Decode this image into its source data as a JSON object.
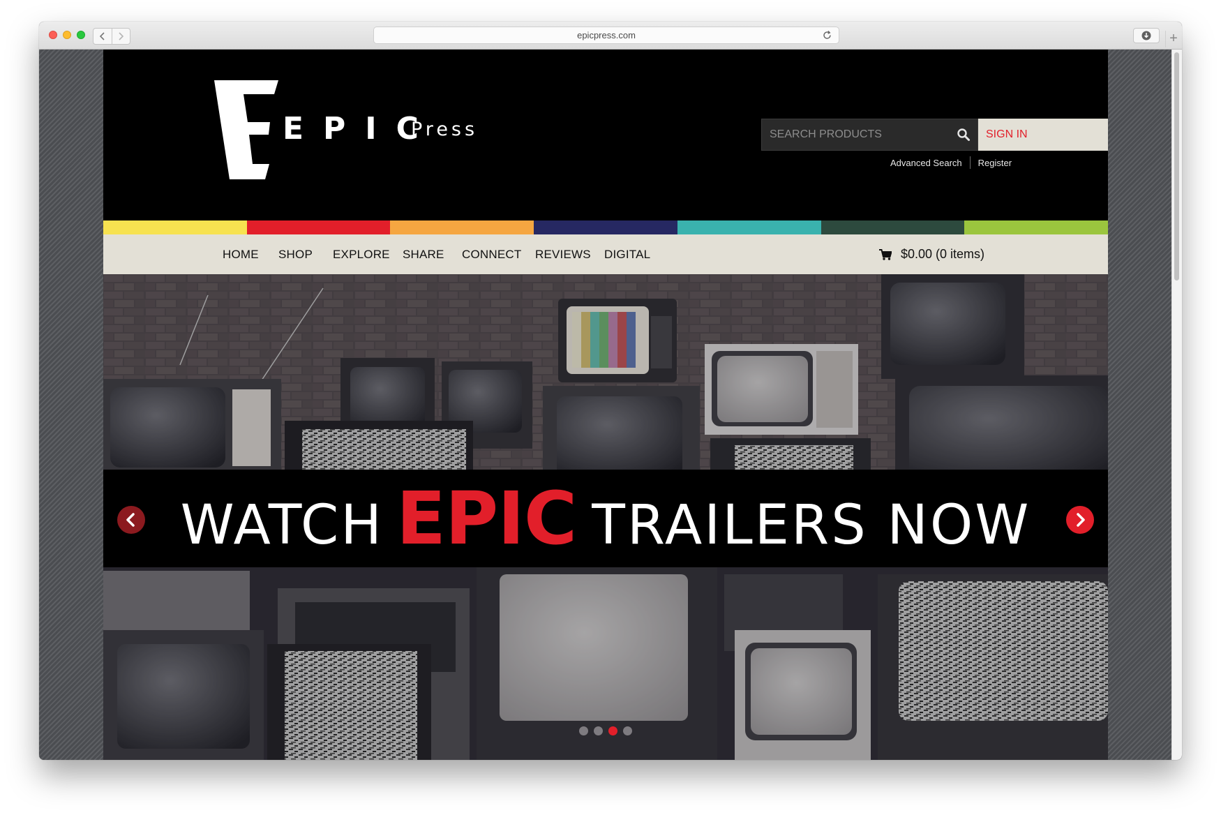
{
  "browser": {
    "url": "epicpress.com",
    "back_icon": "chevron-left-icon",
    "forward_icon": "chevron-right-icon",
    "reload_icon": "reload-icon",
    "download_icon": "download-icon",
    "new_tab_icon": "plus-icon",
    "new_tab_glyph": "+"
  },
  "header": {
    "logo_text": "EPIC",
    "logo_subtext": "Press",
    "search_placeholder": "SEARCH PRODUCTS",
    "search_icon": "search-icon",
    "sign_in_label": "SIGN IN",
    "advanced_search_label": "Advanced Search",
    "register_label": "Register"
  },
  "color_stripes": [
    "#f7e250",
    "#e21f2a",
    "#f5a641",
    "#262862",
    "#3ab2ae",
    "#2d4a3e",
    "#9bc53e"
  ],
  "nav": {
    "items": [
      {
        "label": "HOME"
      },
      {
        "label": "SHOP"
      },
      {
        "label": "EXPLORE"
      },
      {
        "label": "SHARE"
      },
      {
        "label": "CONNECT"
      },
      {
        "label": "REVIEWS"
      },
      {
        "label": "DIGITAL"
      }
    ],
    "cart_icon": "cart-icon",
    "cart_label": "$0.00 (0 items)"
  },
  "hero": {
    "banner_word_1": "WATCH",
    "banner_word_2": "EPIC",
    "banner_word_3": "TRAILERS NOW",
    "prev_icon": "arrow-left-icon",
    "next_icon": "arrow-right-icon",
    "slide_count": 4,
    "active_slide": 3
  },
  "colors": {
    "brand_red": "#e21f2a",
    "nav_bg": "#e3e0d6",
    "header_bg": "#000000"
  }
}
